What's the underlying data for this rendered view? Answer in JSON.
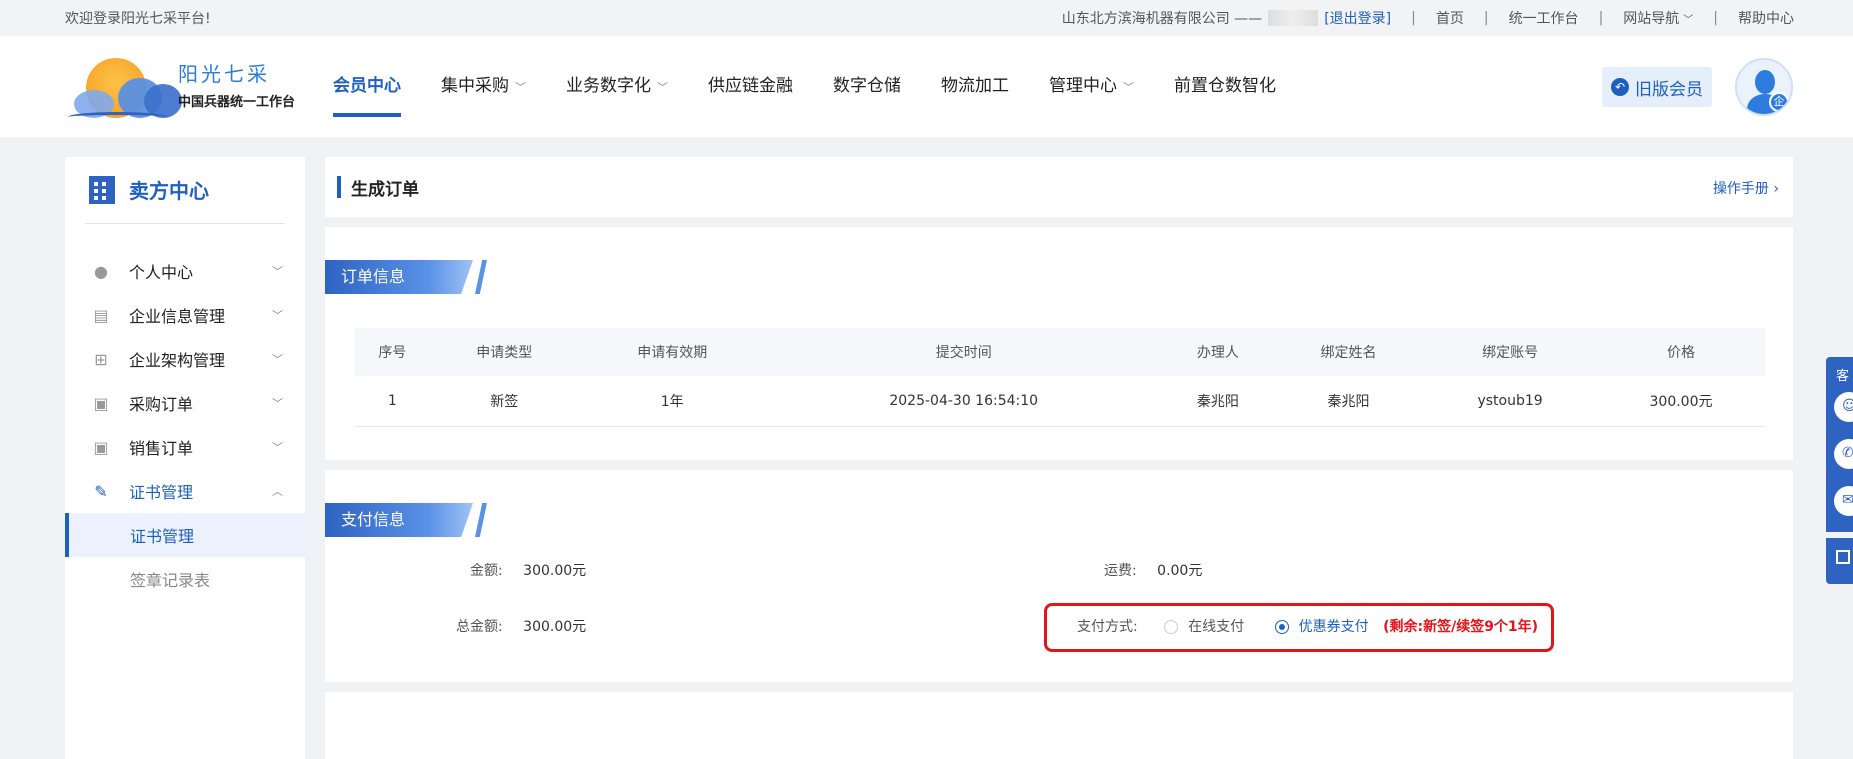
{
  "topbar": {
    "welcome": "欢迎登录阳光七采平台!",
    "company": "山东北方滨海机器有限公司 ——",
    "logout": "[退出登录]",
    "links": [
      "首页",
      "统一工作台",
      "网站导航",
      "帮助中心"
    ]
  },
  "header": {
    "logo_name": "阳光七采",
    "logo_sub": "中国兵器统一工作台",
    "nav": [
      "会员中心",
      "集中采购",
      "业务数字化",
      "供应链金融",
      "数字仓储",
      "物流加工",
      "管理中心",
      "前置仓数智化"
    ],
    "old_member": "旧版会员",
    "avatar_badge": "企"
  },
  "sidebar": {
    "title": "卖方中心",
    "items": [
      "个人中心",
      "企业信息管理",
      "企业架构管理",
      "采购订单",
      "销售订单",
      "证书管理"
    ],
    "sub_items": [
      "证书管理",
      "签章记录表"
    ]
  },
  "page": {
    "title": "生成订单",
    "manual": "操作手册"
  },
  "order_section": {
    "label": "订单信息",
    "headers": [
      "序号",
      "申请类型",
      "申请有效期",
      "提交时间",
      "办理人",
      "绑定姓名",
      "绑定账号",
      "价格"
    ],
    "row": [
      "1",
      "新签",
      "1年",
      "2025-04-30 16:54:10",
      "秦兆阳",
      "秦兆阳",
      "ystoub19",
      "300.00元"
    ]
  },
  "payment_section": {
    "label": "支付信息",
    "amount_label": "金额:",
    "amount_value": "300.00元",
    "freight_label": "运费:",
    "freight_value": "0.00元",
    "total_label": "总金额:",
    "total_value": "300.00元",
    "method_label": "支付方式:",
    "option_online": "在线支付",
    "option_coupon": "优惠券支付",
    "remaining": "(剩余:新签/续签9个1年)"
  },
  "float_bar": {
    "label": "客"
  },
  "colors": {
    "primary": "#1f5fbf",
    "highlight_border": "#e3151a"
  }
}
